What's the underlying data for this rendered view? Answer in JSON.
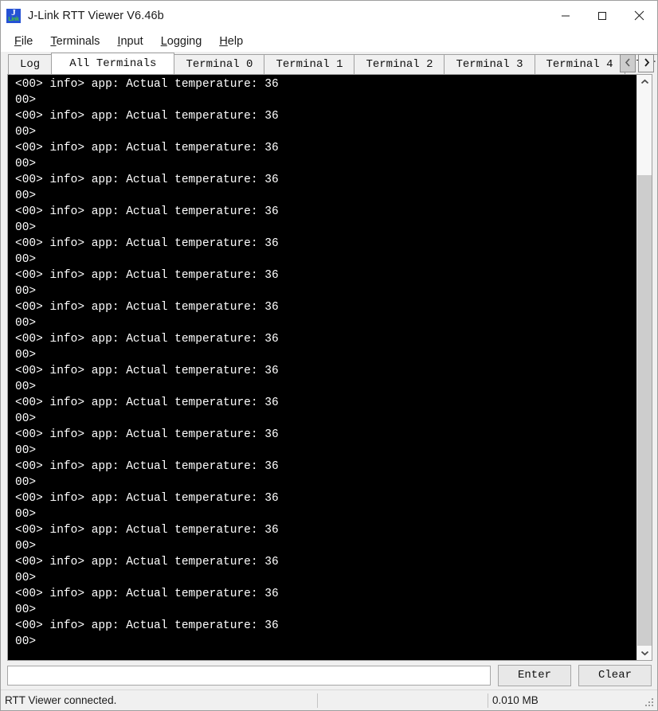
{
  "window": {
    "title": "J-Link RTT Viewer V6.46b",
    "icon": "jlink-logo-icon",
    "controls": {
      "minimize": "minimize-icon",
      "maximize": "maximize-icon",
      "close": "close-icon"
    }
  },
  "menubar": {
    "items": [
      {
        "label": "File",
        "accelerator": "F"
      },
      {
        "label": "Terminals",
        "accelerator": "T"
      },
      {
        "label": "Input",
        "accelerator": "I"
      },
      {
        "label": "Logging",
        "accelerator": "L"
      },
      {
        "label": "Help",
        "accelerator": "H"
      }
    ]
  },
  "tabs": {
    "selected_index": 1,
    "items": [
      {
        "label": "Log"
      },
      {
        "label": "All Terminals"
      },
      {
        "label": "Terminal 0"
      },
      {
        "label": "Terminal 1"
      },
      {
        "label": "Terminal 2"
      },
      {
        "label": "Terminal 3"
      },
      {
        "label": "Terminal 4"
      },
      {
        "label": "Ter"
      }
    ],
    "scroll_left": "chevron-left-icon",
    "scroll_right": "chevron-right-icon"
  },
  "terminal": {
    "background": "#000000",
    "foreground": "#ffffff",
    "lines": [
      "<00> info> app: Actual temperature: 36",
      "00>",
      "<00> info> app: Actual temperature: 36",
      "00>",
      "<00> info> app: Actual temperature: 36",
      "00>",
      "<00> info> app: Actual temperature: 36",
      "00>",
      "<00> info> app: Actual temperature: 36",
      "00>",
      "<00> info> app: Actual temperature: 36",
      "00>",
      "<00> info> app: Actual temperature: 36",
      "00>",
      "<00> info> app: Actual temperature: 36",
      "00>",
      "<00> info> app: Actual temperature: 36",
      "00>",
      "<00> info> app: Actual temperature: 36",
      "00>",
      "<00> info> app: Actual temperature: 36",
      "00>",
      "<00> info> app: Actual temperature: 36",
      "00>",
      "<00> info> app: Actual temperature: 36",
      "00>",
      "<00> info> app: Actual temperature: 36",
      "00>",
      "<00> info> app: Actual temperature: 36",
      "00>",
      "<00> info> app: Actual temperature: 36",
      "00>",
      "<00> info> app: Actual temperature: 36",
      "00>",
      "<00> info> app: Actual temperature: 36",
      "00>"
    ]
  },
  "scrollbar": {
    "up_arrow": "chevron-up-icon",
    "down_arrow": "chevron-down-icon"
  },
  "input_row": {
    "value": "",
    "placeholder": "",
    "enter_label": "Enter",
    "clear_label": "Clear"
  },
  "statusbar": {
    "message": "RTT Viewer connected.",
    "middle": "",
    "data_size": "0.010 MB"
  }
}
